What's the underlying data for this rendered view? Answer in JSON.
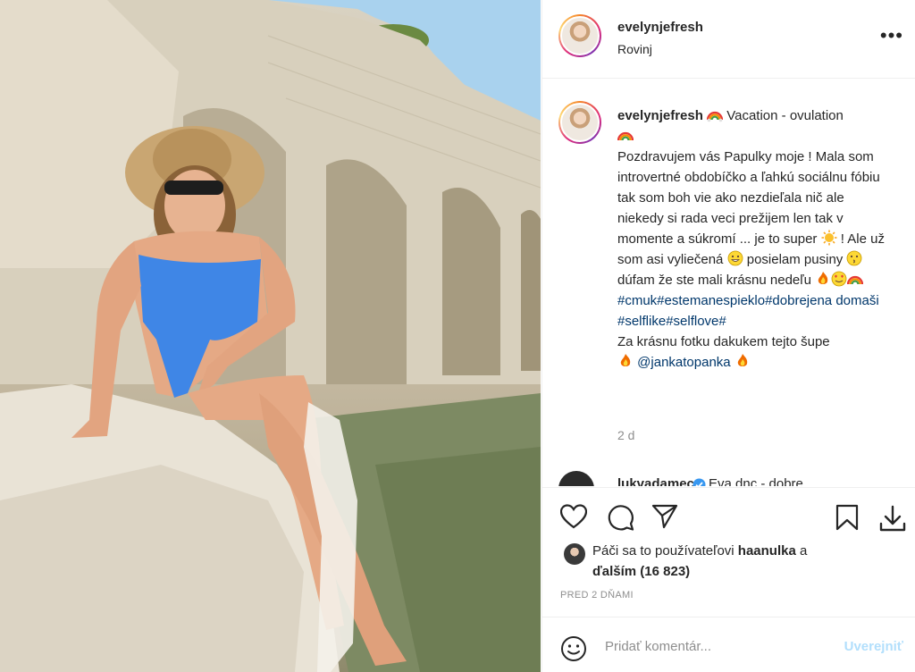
{
  "post": {
    "username": "evelynjefresh",
    "location": "Rovinj"
  },
  "caption": {
    "username": "evelynjefresh",
    "line1": " Vacation - ovulation",
    "body1": "Pozdravujem vás Papulky moje ! Mala som introvertné obdobíčko a ľahkú sociálnu fóbiu tak som boh vie ako nezdieľala nič ale niekedy si rada veci prežijem len tak v momente a súkromí ... je to super ",
    "body2": " ! Ale už som asi vyliečená ",
    "body3": " posielam pusiny ",
    "body4": " dúfam že ste mali krásnu nedeľu ",
    "hashtags": "#cmuk#estemanespieklo#dobrejena domaši #selflike#selflove#",
    "credit": "Za krásnu fotku dakukem tejto šupe",
    "mention": "@jankatopanka"
  },
  "post_age": "2 d",
  "next_comment": {
    "username": "lukvadamec",
    "text": "Eva dnc - dobre"
  },
  "likes": {
    "prefix": "Páči sa to používateľovi ",
    "user": "haanulka",
    "joiner": " a",
    "others": "ďalším (16 823)"
  },
  "timestamp": "PRED 2 DŇAMI",
  "add_comment": {
    "placeholder": "Pridať komentár...",
    "post_label": "Uverejniť"
  },
  "icons": {
    "more": "more-options-icon",
    "like": "heart-icon",
    "comment": "comment-bubble-icon",
    "share": "paper-plane-icon",
    "save": "bookmark-icon",
    "download": "download-icon",
    "emoji": "emoji-smile-icon"
  },
  "colors": {
    "link": "#00376b",
    "muted": "#8e8e8e",
    "post_button": "#b2dffc"
  }
}
